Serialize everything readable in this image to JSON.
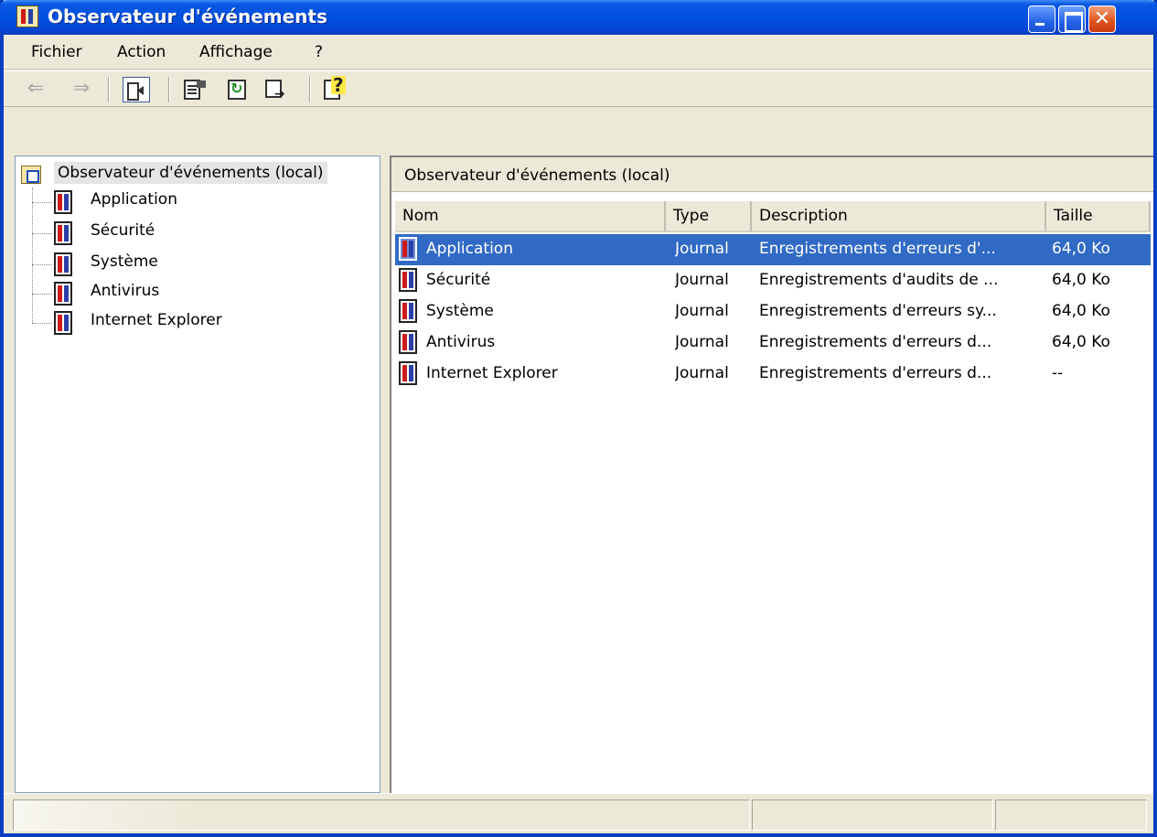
{
  "window": {
    "title": "Observateur d'événements"
  },
  "menu": [
    {
      "label": "Fichier"
    },
    {
      "label": "Action"
    },
    {
      "label": "Affichage"
    },
    {
      "label": "?"
    }
  ],
  "toolbar": {
    "back_icon": "back-arrow-icon",
    "forward_icon": "forward-arrow-icon",
    "show_tree_icon": "show-hide-console-tree-icon",
    "properties_icon": "properties-icon",
    "refresh_icon": "refresh-icon",
    "export_icon": "export-list-icon",
    "help_icon": "help-icon"
  },
  "tree": {
    "root_label": "Observateur d'événements (local)",
    "items": [
      {
        "label": "Application"
      },
      {
        "label": "Sécurité"
      },
      {
        "label": "Système"
      },
      {
        "label": "Antivirus"
      },
      {
        "label": "Internet Explorer"
      }
    ]
  },
  "right_pane": {
    "header": "Observateur d'événements (local)",
    "columns": [
      "Nom",
      "Type",
      "Description",
      "Taille"
    ],
    "rows": [
      {
        "nom": "Application",
        "type": "Journal",
        "description": "Enregistrements d'erreurs d'...",
        "taille": "64,0 Ko",
        "selected": true
      },
      {
        "nom": "Sécurité",
        "type": "Journal",
        "description": "Enregistrements d'audits de ...",
        "taille": "64,0 Ko"
      },
      {
        "nom": "Système",
        "type": "Journal",
        "description": "Enregistrements d'erreurs sy...",
        "taille": "64,0 Ko"
      },
      {
        "nom": "Antivirus",
        "type": "Journal",
        "description": "Enregistrements d'erreurs d...",
        "taille": "64,0 Ko"
      },
      {
        "nom": "Internet Explorer",
        "type": "Journal",
        "description": "Enregistrements d'erreurs d...",
        "taille": "--"
      }
    ]
  },
  "colors": {
    "titlebar": "#0050df",
    "selection": "#316ac5",
    "chrome": "#ece9d8"
  }
}
